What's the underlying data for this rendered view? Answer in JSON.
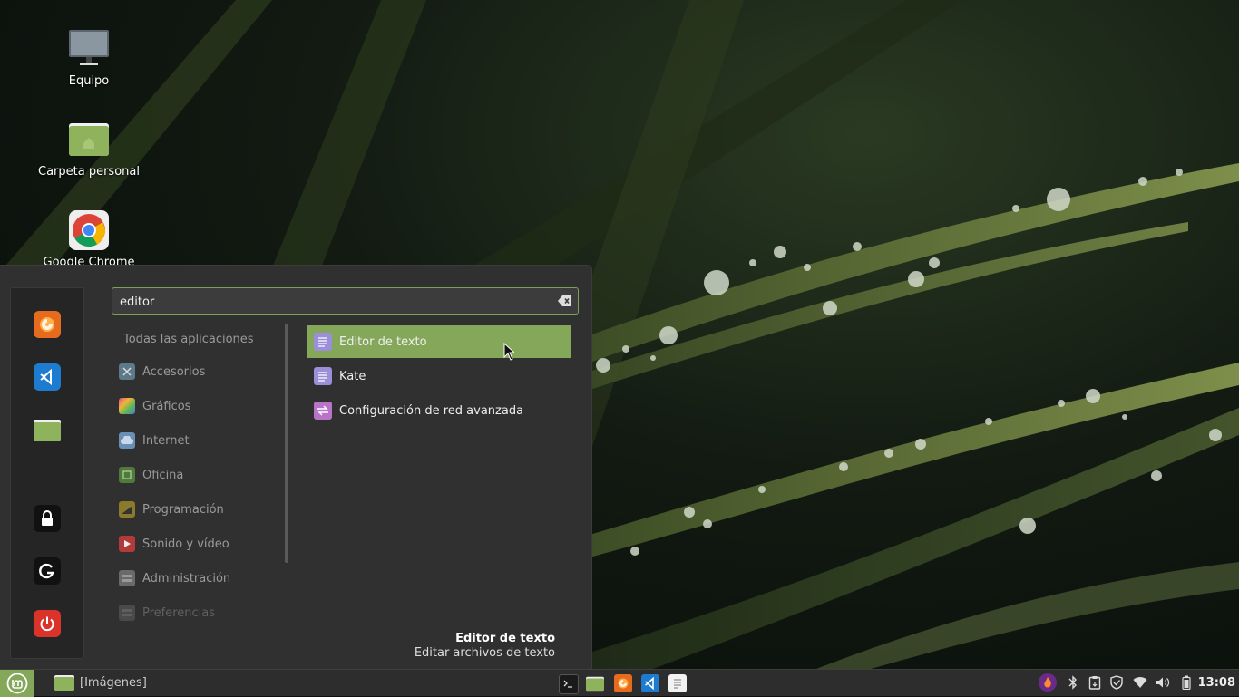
{
  "desktop": {
    "icons": [
      {
        "label": "Equipo",
        "icon": "computer-icon"
      },
      {
        "label": "Carpeta personal",
        "icon": "home-folder-icon"
      },
      {
        "label": "Google Chrome",
        "icon": "chrome-icon"
      }
    ]
  },
  "menu": {
    "favorites": [
      "firefox-icon",
      "vscode-icon",
      "files-icon",
      "lock-icon",
      "logout-icon",
      "power-icon"
    ],
    "search": {
      "value": "editor"
    },
    "all_apps_label": "Todas las aplicaciones",
    "categories": [
      {
        "label": "Accesorios",
        "icon": "accessories-icon"
      },
      {
        "label": "Gráficos",
        "icon": "graphics-icon"
      },
      {
        "label": "Internet",
        "icon": "internet-icon"
      },
      {
        "label": "Oficina",
        "icon": "office-icon"
      },
      {
        "label": "Programación",
        "icon": "programming-icon"
      },
      {
        "label": "Sonido y vídeo",
        "icon": "multimedia-icon"
      },
      {
        "label": "Administración",
        "icon": "administration-icon"
      },
      {
        "label": "Preferencias",
        "icon": "preferences-icon"
      }
    ],
    "results": [
      {
        "label": "Editor de texto",
        "icon": "text-editor-icon",
        "selected": true
      },
      {
        "label": "Kate",
        "icon": "kate-icon",
        "selected": false
      },
      {
        "label": "Configuración de red avanzada",
        "icon": "network-config-icon",
        "selected": false
      }
    ],
    "description": {
      "title": "Editor de texto",
      "text": "Editar archivos de texto"
    }
  },
  "panel": {
    "window_title": "[Imágenes]",
    "launchers": [
      "terminal-icon",
      "files-icon",
      "firefox-icon",
      "vscode-icon",
      "text-editor-icon"
    ],
    "tray": [
      "flame-icon",
      "bluetooth-icon",
      "clipboard-icon",
      "shield-icon",
      "wifi-icon",
      "volume-icon",
      "battery-icon"
    ],
    "clock": "13:08"
  },
  "colors": {
    "accent": "#84a75a",
    "menu_bg": "#303030",
    "panel_bg": "#2d2d2d"
  }
}
